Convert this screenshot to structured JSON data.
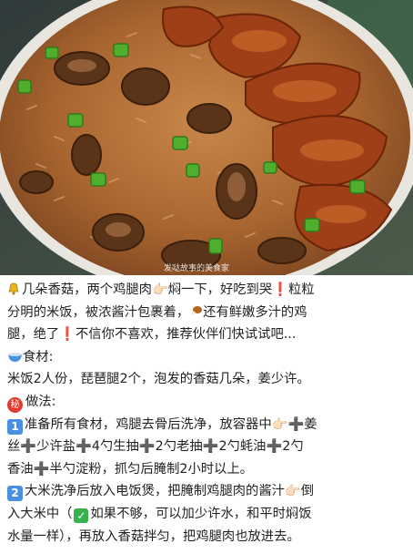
{
  "photo": {
    "watermark": "发哒故事的美食家"
  },
  "text": {
    "intro1": "几朵香菇，两个鸡腿肉👉🏻焖一下，好吃到哭",
    "intro1b": "粒粒",
    "intro2a": "分明的米饭，被浓酱汁包裹着，",
    "intro2b": "还有鲜嫩多汁的鸡",
    "intro3a": "腿，绝了",
    "intro3b": "不信你不喜欢，推荐伙伴们快试试吧...",
    "ingredients_title": "食材:",
    "ingredients": "米饭2人份，琵琶腿2个，泡发的香菇几朵，姜少许。",
    "method_title": "做法:",
    "step1_num": "1",
    "step1_line1a": "准备所有食材，鸡腿去骨后洗净，放容器中👉🏻",
    "step1_line1b": "姜",
    "step1_line2a": "丝",
    "step1_line2b": "少许盐",
    "step1_line2c": "4勺生抽",
    "step1_line2d": "2勺老抽",
    "step1_line2e": "2勺蚝油",
    "step1_line2f": "2勺",
    "step1_line3a": "香油",
    "step1_line3b": "半勺淀粉，抓匀后腌制2小时以上。",
    "step2_num": "2",
    "step2_line1": "大米洗净后放入电饭煲，把腌制鸡腿肉的酱汁👉🏻倒",
    "step2_line2a": "入大米中（",
    "step2_line2b": "如果不够，可以加少许水，和平时焖饭",
    "step2_line3": "水量一样），再放入香菇拌匀，把鸡腿肉也放进去。"
  },
  "icons": {
    "bell": "bell-icon",
    "chicken": "drumstick-icon",
    "bowl": "bowl-icon",
    "secret": "secret-icon",
    "exclaim": "red-exclamation-icon",
    "plus": "plus-icon",
    "check": "check-icon"
  },
  "colors": {
    "red": "#e0231c",
    "step_badge": "#4a8fe0",
    "check": "#37b24d"
  }
}
